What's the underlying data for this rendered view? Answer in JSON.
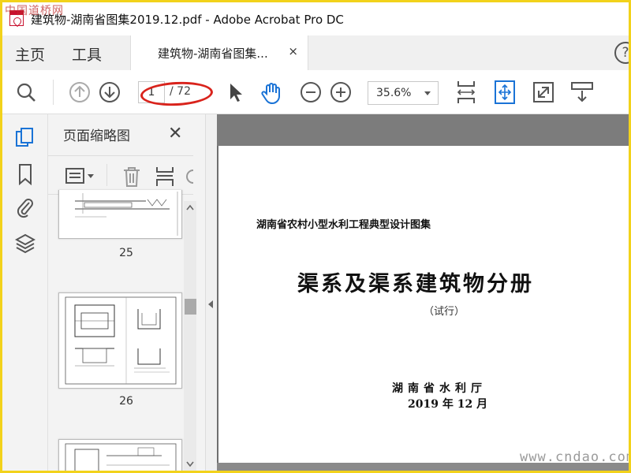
{
  "window": {
    "title": "建筑物-湖南省图集2019.12.pdf - Adobe Acrobat Pro DC",
    "watermark_top": "中国道桥网",
    "watermark_bottom": "www.cndao.com"
  },
  "tabs": {
    "home": "主页",
    "tools": "工具",
    "document": "建筑物-湖南省图集...",
    "close": "×",
    "help": "?"
  },
  "toolbar": {
    "current_page": "1",
    "total_pages": "/ 72",
    "zoom": "35.6%"
  },
  "panel": {
    "title": "页面缩略图",
    "close": "✕",
    "thumbnails": [
      {
        "label": "25"
      },
      {
        "label": "26"
      }
    ]
  },
  "page": {
    "subtitle": "湖南省农村小型水利工程典型设计图集",
    "title": "渠系及渠系建筑物分册",
    "trial": "（试行）",
    "org": "湖南省水利厅",
    "date": "2019 年 12 月"
  },
  "colors": {
    "highlight": "#d9231c",
    "accent_blue": "#1a73d6",
    "frame": "#f2d21b"
  }
}
